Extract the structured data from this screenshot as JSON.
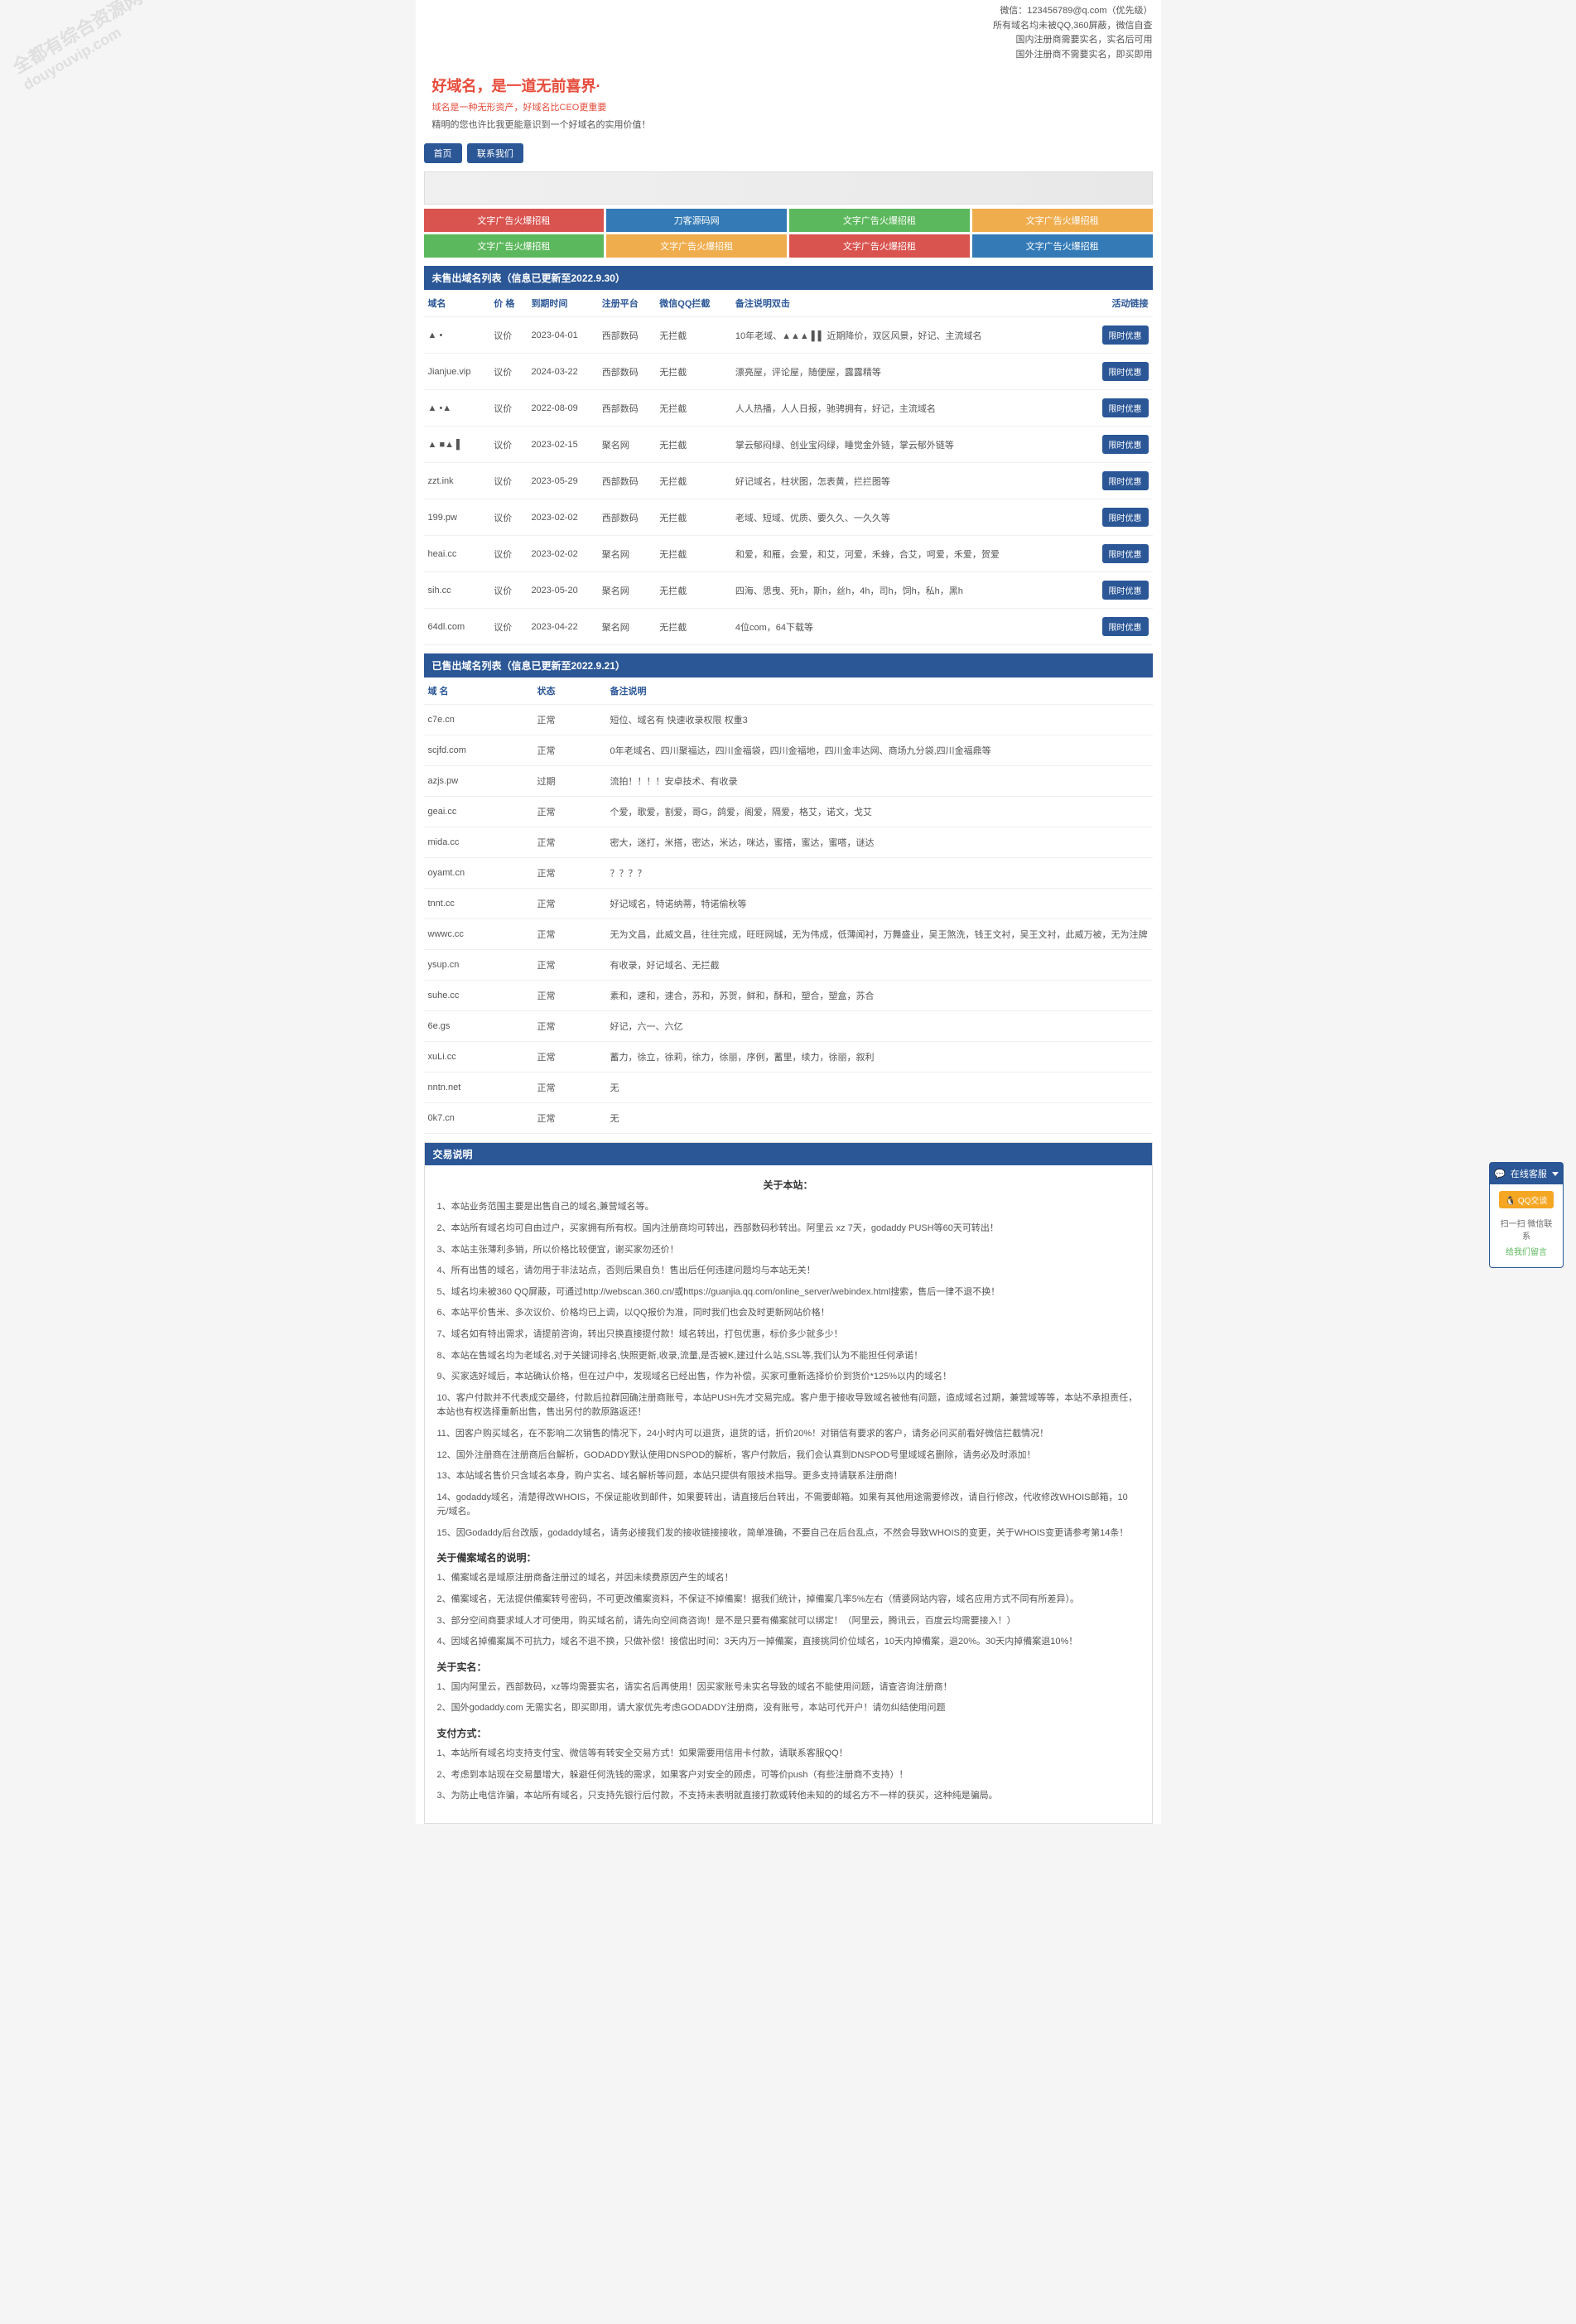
{
  "watermark": {
    "line1": "全都有综合资源网",
    "line2": "douyouvip.com"
  },
  "headerInfo": {
    "wechat": "微信：123456789@q.com（优先级）",
    "domain": "所有域名均未被QQ,360屏蔽，微信自查",
    "domestic": "国内注册商需要实名，实名后可用",
    "foreign": "国外注册商不需要实名，即买即用"
  },
  "slogan": {
    "main": "好域名，是一道无前喜界·",
    "sub1": "域名是一种无形资产，好域名比CEO更重要",
    "sub2": "精明的您也许比我更能意识到一个好域名的实用价值！"
  },
  "nav": {
    "home": "首页",
    "contact": "联系我们"
  },
  "adRow1": [
    {
      "text": "文字广告火爆招租",
      "class": "ad-red"
    },
    {
      "text": "刀客源码网",
      "class": "ad-blue"
    },
    {
      "text": "文字广告火爆招租",
      "class": "ad-green"
    },
    {
      "text": "文字广告火爆招租",
      "class": "ad-orange"
    }
  ],
  "adRow2": [
    {
      "text": "文字广告火爆招租",
      "class": "ad-green"
    },
    {
      "text": "文字广告火爆招租",
      "class": "ad-orange"
    },
    {
      "text": "文字广告火爆招租",
      "class": "ad-red"
    },
    {
      "text": "文字广告火爆招租",
      "class": "ad-blue"
    }
  ],
  "unsoldSection": {
    "title": "未售出域名列表（信息已更新至2022.9.30）",
    "headers": {
      "domain": "域名",
      "price": "价 格",
      "expire": "到期时间",
      "platform": "注册平台",
      "wechat": "微信QQ拦截",
      "remark": "备注说明双击",
      "action": "活动链接"
    },
    "rows": [
      {
        "domain": "▲ •",
        "price": "议价",
        "expire": "2023-04-01",
        "platform": "西部数码",
        "wechat": "无拦截",
        "remark": "10年老域、▲▲▲ ▌▌ 近期降价，双区风景，好记、主流域名",
        "action": "限时优惠"
      },
      {
        "domain": "Jianjue.vip",
        "price": "议价",
        "expire": "2024-03-22",
        "platform": "西部数码",
        "wechat": "无拦截",
        "remark": "漂亮屋，评论屋，随便屋，露露精等",
        "action": "限时优惠"
      },
      {
        "domain": "▲ •▲",
        "price": "议价",
        "expire": "2022-08-09",
        "platform": "西部数码",
        "wechat": "无拦截",
        "remark": "人人热播，人人日报，驰骋拥有，好记，主流域名",
        "action": "限时优惠"
      },
      {
        "domain": "▲ ■▲ ▌",
        "price": "议价",
        "expire": "2023-02-15",
        "platform": "聚名网",
        "wechat": "无拦截",
        "remark": "掌云郁闷绿、创业宝闷绿，睡觉金外链，掌云郁外链等",
        "action": "限时优惠"
      },
      {
        "domain": "zzt.ink",
        "price": "议价",
        "expire": "2023-05-29",
        "platform": "西部数码",
        "wechat": "无拦截",
        "remark": "好记域名，柱状图，怎表黄，拦拦图等",
        "action": "限时优惠"
      },
      {
        "domain": "199.pw",
        "price": "议价",
        "expire": "2023-02-02",
        "platform": "西部数码",
        "wechat": "无拦截",
        "remark": "老域、短域、优质、要久久、一久久等",
        "action": "限时优惠"
      },
      {
        "domain": "heai.cc",
        "price": "议价",
        "expire": "2023-02-02",
        "platform": "聚名网",
        "wechat": "无拦截",
        "remark": "和爱，和雁，会爱，和艾，河爱，禾蜂，合艾，呵爱，禾爱，贺爱",
        "action": "限时优惠"
      },
      {
        "domain": "sih.cc",
        "price": "议价",
        "expire": "2023-05-20",
        "platform": "聚名网",
        "wechat": "无拦截",
        "remark": "四海、思曳、死h，斯h，丝h，4h，司h，饲h，私h，黑h",
        "action": "限时优惠"
      },
      {
        "domain": "64dl.com",
        "price": "议价",
        "expire": "2023-04-22",
        "platform": "聚名网",
        "wechat": "无拦截",
        "remark": "4位com，64下载等",
        "action": "限时优惠"
      }
    ]
  },
  "soldSection": {
    "title": "已售出域名列表（信息已更新至2022.9.21）",
    "headers": {
      "domain": "域 名",
      "status": "状态",
      "remark": "备注说明"
    },
    "rows": [
      {
        "domain": "c7e.cn",
        "status": "正常",
        "remark": "短位、域名有 快速收录权限 权重3"
      },
      {
        "domain": "scjfd.com",
        "status": "正常",
        "remark": "0年老域名、四川聚福达，四川金福袋，四川金福地，四川金丰达网、商场九分袋,四川金福鼎等"
      },
      {
        "domain": "azjs.pw",
        "status": "过期",
        "remark": "流拍！！！！安卓技术、有收录"
      },
      {
        "domain": "geai.cc",
        "status": "正常",
        "remark": "个爱，歌爱，割爱，哥G，鸽爱，阁爱，隔爱，格艾，诺文，戈艾"
      },
      {
        "domain": "mida.cc",
        "status": "正常",
        "remark": "密大，迷打，米搭，密达，米达，咪达，蜜搭，蜜达，蜜嗒，谜达"
      },
      {
        "domain": "oyamt.cn",
        "status": "正常",
        "remark": "？？？？"
      },
      {
        "domain": "tnnt.cc",
        "status": "正常",
        "remark": "好记域名，特诺纳蒂，特诺偷秋等"
      },
      {
        "domain": "wwwc.cc",
        "status": "正常",
        "remark": "无为文昌，此威文昌，往往完成，旺旺网城，无为伟成，低薄闻衬，万舞盛业，吴王煞洗，钱王文衬，吴王文衬，此威万被，无为注牌"
      },
      {
        "domain": "ysup.cn",
        "status": "正常",
        "remark": "有收录，好记域名、无拦截"
      },
      {
        "domain": "suhe.cc",
        "status": "正常",
        "remark": "素和，速和，速合，苏和，苏贺，鲜和，酥和，塑合，塑盒，苏合"
      },
      {
        "domain": "6e.gs",
        "status": "正常",
        "remark": "好记，六一、六亿"
      },
      {
        "domain": "xuLi.cc",
        "status": "正常",
        "remark": "蓄力，徐立，徐莉，徐力，徐丽，序例，蓄里，续力，徐丽，叙利"
      },
      {
        "domain": "nntn.net",
        "status": "正常",
        "remark": "无"
      },
      {
        "domain": "0k7.cn",
        "status": "正常",
        "remark": "无"
      }
    ]
  },
  "tradeInfo": {
    "header": "交易说明",
    "aboutTitle": "关于本站：",
    "aboutItems": [
      "1、本站业务范围主要是出售自己的域名,兼营域名等。",
      "2、本站所有域名均可自由过户，买家拥有所有权。国内注册商均可转出，西部数码秒转出。阿里云 xz 7天，godaddy PUSH等60天可转出！",
      "3、本站主张薄利多销，所以价格比较便宜，谢买家勿还价！",
      "4、所有出售的域名，请勿用于非法站点，否则后果自负！售出后任何违建问题均与本站无关！",
      "5、域名均未被360 QQ屏蔽，可通过http://webscan.360.cn/或https://guanjia.qq.com/online_server/webindex.html搜索，售后一律不退不换！",
      "6、本站平价售米、多次议价、价格均已上调，以QQ报价为准，同时我们也会及时更新网站价格！",
      "7、域名如有特出需求，请提前咨询，转出只换直接提付款！域名转出，打包优惠，标价多少就多少！",
      "8、本站在售域名均为老域名,对于关键词排名,快照更新,收录,流量,是否被K,建过什么站,SSL等,我们认为不能担任何承诺！",
      "9、买家选好域后，本站确认价格，但在过户中，发现域名已经出售，作为补偿，买家可重新选择价价到货价*125%以内的域名！",
      "10、客户付款并不代表成交最终，付款后拉群回确注册商账号，本站PUSH先才交易完成。客户患于接收导致域名被他有问题，造成域名过期，兼营域等等，本站不承担责任，本站也有权选择重新出售，售出另付的款原路返还！",
      "11、因客户购买域名，在不影响二次销售的情况下，24小时内可以退货，退货的话，折价20%！对销信有要求的客户，请务必问买前看好微信拦截情况！",
      "12、国外注册商在注册商后台解析，GODADDY默认使用DNSPOD的解析，客户付款后，我们会认真到DNSPOD号里域域名删除，请务必及时添加！",
      "13、本站域名售价只含域名本身，购户实名、域名解析等问题，本站只提供有限技术指导。更多支持请联系注册商！",
      "14、godaddy域名，清楚得改WHOIS，不保证能收到邮件，如果要转出，请直接后台转出，不需要邮箱。如果有其他用途需要修改，请自行修改，代收修改WHOIS邮箱，10元/域名。",
      "15、因Godaddy后台改版，godaddy域名，请务必接我们发的接收链接接收，简单准确，不要自己在后台乱点，不然会导致WHOIS的变更，关于WHOIS变更请参考第14条！"
    ],
    "beianTitle": "关于備案域名的说明：",
    "beianItems": [
      "1、備案域名是域原注册商备注册过的域名，并因未续费原因产生的域名！",
      "2、備案域名，无法提供備案转号密码，不可更改備案资料，不保证不掉備案！据我们统计，掉備案几率5%左右（情婆网站内容，域名应用方式不同有所差异）。",
      "3、部分空间商要求域人才可使用，购买域名前，请先向空间商咨询！是不是只要有備案就可以绑定！（阿里云，腾讯云，百度云均需要接入！）",
      "4、因域名掉備案属不可抗力，域名不退不换，只做补偿！接偿出时间：3天内万一掉備案，直接挑同价位域名，10天内掉備案，退20%。30天内掉備案退10%！"
    ],
    "realnameTitle": "关于实名：",
    "realnameItems": [
      "1、国内阿里云，西部数码，xz等均需要实名，请实名后再使用！因买家账号未实名导致的域名不能使用问题，请查咨询注册商！",
      "2、国外godaddy.com 无需实名，即买即用，请大家优先考虑GODADDY注册商，没有账号，本站可代开户！请勿纠结使用问题"
    ],
    "payTitle": "支付方式：",
    "payItems": [
      "1、本站所有域名均支持支付宝、微信等有转安全交易方式！如果需要用信用卡付款，请联系客服QQ！",
      "2、考虑到本站现在交易量增大，躲避任何洗钱的需求，如果客户对安全的顾虑，可等价push（有些注册商不支持）！",
      "3、为防止电信诈骗，本站所有域名，只支持先银行后付款，不支持未表明就直接打款或转他未知的的域名方不一样的获买，这种纯是骗局。"
    ]
  },
  "support": {
    "header": "在线客服",
    "qqBtn": "QQ交谈",
    "wechat": "扫一扫 微信联系",
    "feedback": "给我们留言"
  }
}
